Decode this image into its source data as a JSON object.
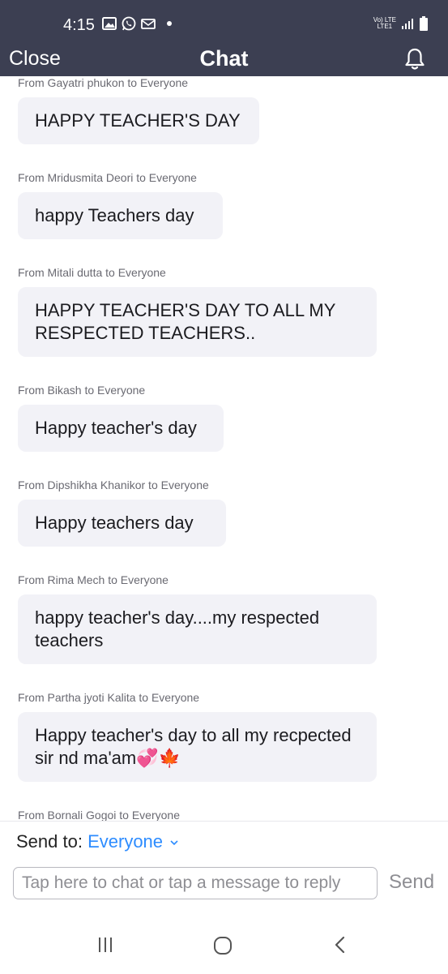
{
  "status_bar": {
    "time": "4:15",
    "network_top": "Vo) LTE",
    "network_bottom": "LTE1"
  },
  "header": {
    "close_label": "Close",
    "title": "Chat"
  },
  "messages": [
    {
      "meta": "From Gayatri phukon to Everyone",
      "text": "HAPPY TEACHER'S DAY"
    },
    {
      "meta": "From Mridusmita Deori to Everyone",
      "text": "happy Teachers day"
    },
    {
      "meta": "From Mitali dutta to Everyone",
      "text": "HAPPY TEACHER'S  DAY TO ALL MY RESPECTED  TEACHERS.."
    },
    {
      "meta": "From Bikash to Everyone",
      "text": "Happy teacher's day"
    },
    {
      "meta": "From Dipshikha Khanikor to Everyone",
      "text": "Happy teachers day"
    },
    {
      "meta": "From Rima Mech to Everyone",
      "text": "happy teacher's day....my respected teachers"
    },
    {
      "meta": "From Partha jyoti Kalita to Everyone",
      "text": "Happy teacher's day to all my recpected sir nd ma'am💞🍁"
    },
    {
      "meta": "From Bornali Gogoi to Everyone",
      "text": ""
    }
  ],
  "footer": {
    "send_to_label": "Send to:",
    "send_to_value": "Everyone",
    "input_placeholder": "Tap here to chat or tap a message to reply",
    "send_label": "Send"
  },
  "colors": {
    "header_bg": "#3c3f52",
    "bubble_bg": "#f2f2f7",
    "accent": "#2d8cff"
  }
}
